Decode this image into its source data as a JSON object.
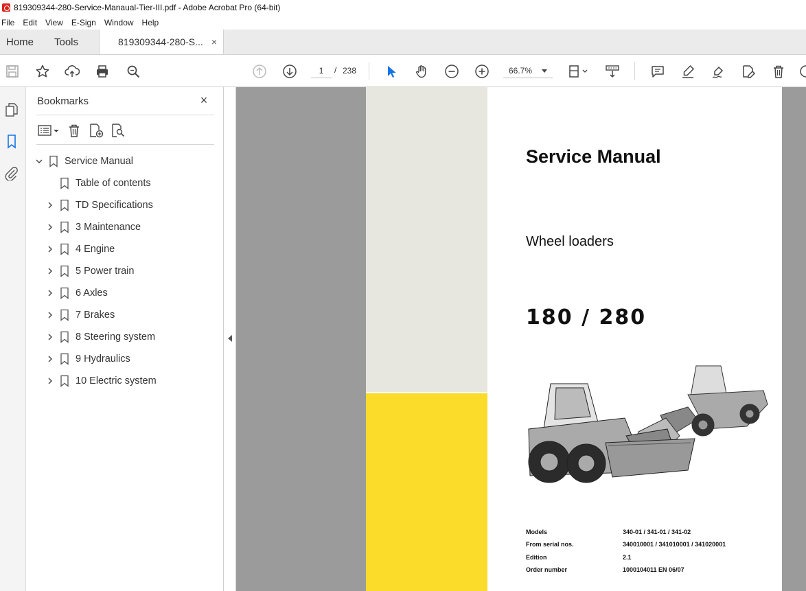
{
  "window": {
    "title": "819309344-280-Service-Manaual-Tier-III.pdf - Adobe Acrobat Pro (64-bit)"
  },
  "menu": [
    "File",
    "Edit",
    "View",
    "E-Sign",
    "Window",
    "Help"
  ],
  "tabs": {
    "home": "Home",
    "tools": "Tools",
    "document": "819309344-280-S...",
    "close": "×"
  },
  "toolbar": {
    "current_page": "1",
    "page_separator": "/",
    "total_pages": "238",
    "zoom": "66.7%",
    "icons": [
      "save-icon",
      "star-icon",
      "upload-icon",
      "print-icon",
      "search-icon",
      "prev-page-icon",
      "next-page-icon",
      "select-arrow-icon",
      "hand-icon",
      "zoom-out-icon",
      "zoom-in-icon",
      "page-fit-icon",
      "scroll-mode-icon",
      "comment-icon",
      "highlight-icon",
      "sign-icon",
      "edit-icon",
      "delete-icon"
    ]
  },
  "bookmarks_panel": {
    "title": "Bookmarks",
    "close": "×",
    "items": [
      {
        "label": "Service Manual",
        "level": 0,
        "expanded": true
      },
      {
        "label": "Table of contents",
        "level": 1,
        "has_children": false
      },
      {
        "label": "TD Specifications",
        "level": 1,
        "has_children": true
      },
      {
        "label": "3 Maintenance",
        "level": 1,
        "has_children": true
      },
      {
        "label": "4 Engine",
        "level": 1,
        "has_children": true
      },
      {
        "label": "5 Power train",
        "level": 1,
        "has_children": true
      },
      {
        "label": "6 Axles",
        "level": 1,
        "has_children": true
      },
      {
        "label": "7 Brakes",
        "level": 1,
        "has_children": true
      },
      {
        "label": "8 Steering system",
        "level": 1,
        "has_children": true
      },
      {
        "label": "9 Hydraulics",
        "level": 1,
        "has_children": true
      },
      {
        "label": "10 Electric system",
        "level": 1,
        "has_children": true
      }
    ]
  },
  "document": {
    "title": "Service Manual",
    "subtitle": "Wheel loaders",
    "model": "180 / 280",
    "info": [
      {
        "key": "Models",
        "value": "340-01 / 341-01 / 341-02"
      },
      {
        "key": "From serial nos.",
        "value": "340010001 / 341010001 / 341020001"
      },
      {
        "key": "Edition",
        "value": "2.1"
      },
      {
        "key": "Order number",
        "value": "1000104011 EN 06/07"
      }
    ]
  },
  "colors": {
    "accent": "#1473e6",
    "band_gray": "#e7e7e0",
    "band_yellow": "#fcdc2a",
    "canvas": "#9b9b9b"
  }
}
